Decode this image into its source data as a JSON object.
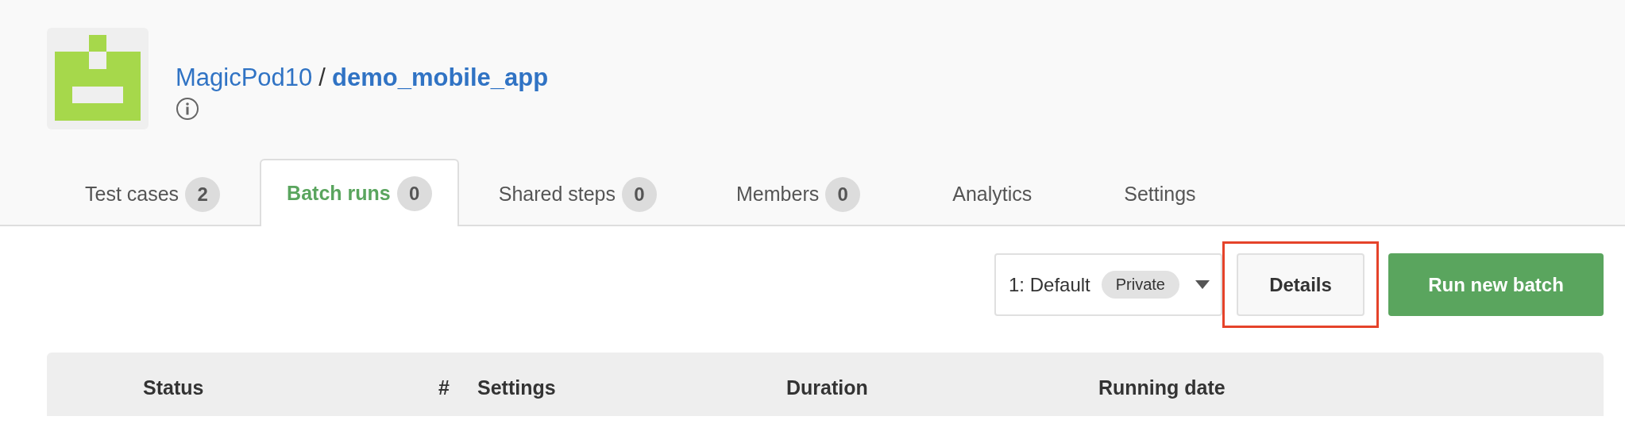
{
  "project": {
    "owner": "MagicPod10",
    "separator": "/",
    "name": "demo_mobile_app"
  },
  "tabs": [
    {
      "label": "Test cases",
      "count": "2",
      "selected": false
    },
    {
      "label": "Batch runs",
      "count": "0",
      "selected": true
    },
    {
      "label": "Shared steps",
      "count": "0",
      "selected": false
    },
    {
      "label": "Members",
      "count": "0",
      "selected": false
    },
    {
      "label": "Analytics",
      "selected": false
    },
    {
      "label": "Settings",
      "selected": false
    }
  ],
  "toolbar": {
    "setting_select": {
      "value": "1: Default",
      "badge": "Private"
    },
    "details_button": {
      "label": "Details",
      "highlighted": true
    },
    "run_button": {
      "label": "Run new batch"
    }
  },
  "table": {
    "columns": [
      "Status",
      "#",
      "Settings",
      "Duration",
      "Running date"
    ]
  }
}
